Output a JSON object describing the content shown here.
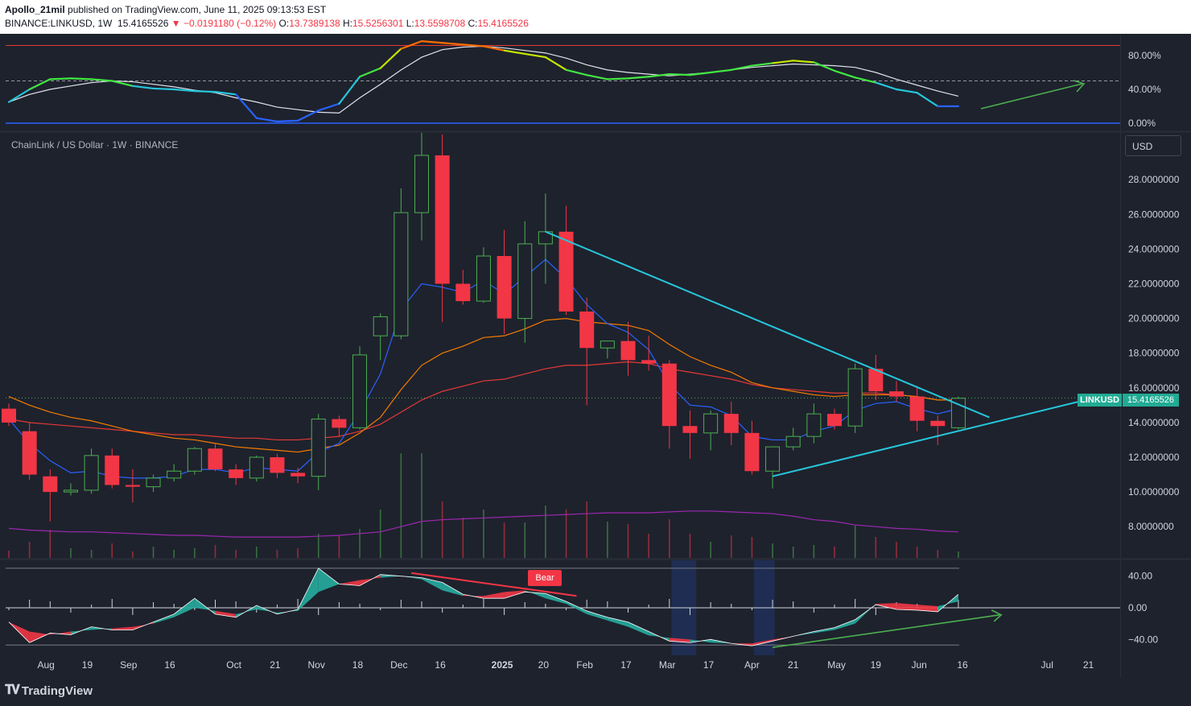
{
  "header": {
    "author": "Apollo_21mil",
    "published": "published on TradingView.com, June 11, 2025 09:13:53 EST",
    "symbol": "BINANCE:LINKUSD, 1W",
    "last": "15.4165526",
    "change": "▼ −0.0191180 (−0.12%)",
    "o_label": "O:",
    "o": "13.7389138",
    "h_label": "H:",
    "h": "15.5256301",
    "l_label": "L:",
    "l": "13.5598708",
    "c_label": "C:",
    "c": "15.4165526"
  },
  "main_legend": "ChainLink / US Dollar · 1W · BINANCE",
  "currency_button": "USD",
  "price_tag": {
    "symbol": "LINKUSD",
    "value": "15.4165526"
  },
  "bear_label": "Bear",
  "footer_logo": "TradingView",
  "colors": {
    "up": "#4caf50",
    "down": "#f23645",
    "bg": "#1e222d",
    "ema_fast": "#2962ff",
    "ema_mid": "#f57c00",
    "ema_slow": "#e53935",
    "volume_ma": "#9c27b0",
    "trend": "#26c6da"
  },
  "chart_data": [
    {
      "type": "candlestick",
      "title": "ChainLink / US Dollar · 1W · BINANCE",
      "x_ticks": [
        "Aug",
        "19",
        "Sep",
        "16",
        "Oct",
        "21",
        "Nov",
        "18",
        "Dec",
        "16",
        "2025",
        "20",
        "Feb",
        "17",
        "Mar",
        "17",
        "Apr",
        "21",
        "May",
        "19",
        "Jun",
        "16",
        "Jul",
        "21"
      ],
      "y_ticks": [
        "28.0000000",
        "26.0000000",
        "24.0000000",
        "22.0000000",
        "20.0000000",
        "18.0000000",
        "16.0000000",
        "14.0000000",
        "12.0000000",
        "10.0000000",
        "8.0000000"
      ],
      "ylim": [
        6.2,
        30.7
      ],
      "last_price": 15.4165526,
      "candles": [
        {
          "o": 14.8,
          "h": 15.1,
          "l": 13.8,
          "c": 14.0
        },
        {
          "o": 13.5,
          "h": 14.0,
          "l": 10.7,
          "c": 11.0
        },
        {
          "o": 10.9,
          "h": 11.3,
          "l": 8.3,
          "c": 10.0
        },
        {
          "o": 10.0,
          "h": 10.5,
          "l": 9.8,
          "c": 10.1
        },
        {
          "o": 10.1,
          "h": 12.5,
          "l": 9.9,
          "c": 12.1
        },
        {
          "o": 12.1,
          "h": 12.5,
          "l": 10.2,
          "c": 10.4
        },
        {
          "o": 10.4,
          "h": 11.3,
          "l": 9.4,
          "c": 10.3
        },
        {
          "o": 10.3,
          "h": 11.0,
          "l": 10.0,
          "c": 10.8
        },
        {
          "o": 10.8,
          "h": 11.6,
          "l": 10.6,
          "c": 11.2
        },
        {
          "o": 11.2,
          "h": 12.6,
          "l": 11.0,
          "c": 12.5
        },
        {
          "o": 12.5,
          "h": 12.8,
          "l": 11.2,
          "c": 11.3
        },
        {
          "o": 11.3,
          "h": 11.6,
          "l": 10.4,
          "c": 10.8
        },
        {
          "o": 10.8,
          "h": 12.1,
          "l": 10.6,
          "c": 12.0
        },
        {
          "o": 12.0,
          "h": 12.2,
          "l": 10.8,
          "c": 11.1
        },
        {
          "o": 11.1,
          "h": 11.4,
          "l": 10.5,
          "c": 10.9
        },
        {
          "o": 10.9,
          "h": 14.5,
          "l": 10.1,
          "c": 14.2
        },
        {
          "o": 14.2,
          "h": 14.4,
          "l": 13.2,
          "c": 13.7
        },
        {
          "o": 13.7,
          "h": 18.4,
          "l": 13.6,
          "c": 17.9
        },
        {
          "o": 19.0,
          "h": 20.3,
          "l": 17.6,
          "c": 20.1
        },
        {
          "o": 19.0,
          "h": 27.5,
          "l": 18.8,
          "c": 26.1
        },
        {
          "o": 26.1,
          "h": 30.7,
          "l": 24.5,
          "c": 29.4
        },
        {
          "o": 29.4,
          "h": 30.6,
          "l": 19.8,
          "c": 22.0
        },
        {
          "o": 22.0,
          "h": 22.8,
          "l": 20.8,
          "c": 21.0
        },
        {
          "o": 21.0,
          "h": 24.1,
          "l": 20.9,
          "c": 23.6
        },
        {
          "o": 23.6,
          "h": 25.1,
          "l": 19.1,
          "c": 20.0
        },
        {
          "o": 20.0,
          "h": 25.6,
          "l": 18.6,
          "c": 24.3
        },
        {
          "o": 24.3,
          "h": 27.2,
          "l": 22.0,
          "c": 25.0
        },
        {
          "o": 25.0,
          "h": 26.5,
          "l": 20.2,
          "c": 20.4
        },
        {
          "o": 20.4,
          "h": 21.2,
          "l": 15.0,
          "c": 18.3
        },
        {
          "o": 18.3,
          "h": 18.7,
          "l": 17.7,
          "c": 18.7
        },
        {
          "o": 18.7,
          "h": 19.8,
          "l": 16.7,
          "c": 17.6
        },
        {
          "o": 17.6,
          "h": 19.0,
          "l": 17.0,
          "c": 17.4
        },
        {
          "o": 17.4,
          "h": 17.6,
          "l": 12.5,
          "c": 13.8
        },
        {
          "o": 13.8,
          "h": 14.7,
          "l": 11.9,
          "c": 13.4
        },
        {
          "o": 13.4,
          "h": 14.7,
          "l": 12.4,
          "c": 14.5
        },
        {
          "o": 14.5,
          "h": 15.2,
          "l": 12.7,
          "c": 13.4
        },
        {
          "o": 13.4,
          "h": 14.1,
          "l": 11.0,
          "c": 11.2
        },
        {
          "o": 11.2,
          "h": 12.6,
          "l": 10.2,
          "c": 12.6
        },
        {
          "o": 12.6,
          "h": 13.7,
          "l": 12.4,
          "c": 13.2
        },
        {
          "o": 13.2,
          "h": 15.1,
          "l": 12.8,
          "c": 14.5
        },
        {
          "o": 14.5,
          "h": 14.8,
          "l": 13.6,
          "c": 13.8
        },
        {
          "o": 13.8,
          "h": 17.4,
          "l": 13.4,
          "c": 17.1
        },
        {
          "o": 17.1,
          "h": 17.9,
          "l": 15.3,
          "c": 15.8
        },
        {
          "o": 15.8,
          "h": 16.4,
          "l": 15.2,
          "c": 15.5
        },
        {
          "o": 15.5,
          "h": 16.1,
          "l": 13.5,
          "c": 14.1
        },
        {
          "o": 14.1,
          "h": 14.4,
          "l": 12.7,
          "c": 13.8
        },
        {
          "o": 13.7,
          "h": 15.5,
          "l": 13.6,
          "c": 15.4
        }
      ],
      "ema_fast": [
        14.2,
        12.8,
        11.8,
        11.1,
        11.2,
        10.9,
        10.8,
        10.8,
        10.9,
        11.3,
        11.3,
        11.1,
        11.4,
        11.3,
        11.2,
        12.3,
        12.8,
        14.6,
        16.8,
        20.5,
        22.0,
        21.8,
        21.5,
        22.2,
        21.4,
        22.4,
        23.4,
        22.3,
        20.8,
        19.7,
        19.2,
        18.2,
        16.2,
        15.0,
        14.9,
        14.4,
        13.2,
        13.0,
        13.0,
        13.5,
        13.8,
        14.7,
        15.1,
        15.2,
        14.8,
        14.5,
        14.8
      ],
      "ema_mid": [
        15.5,
        15.0,
        14.6,
        14.3,
        14.1,
        13.8,
        13.5,
        13.3,
        13.1,
        13.0,
        12.8,
        12.6,
        12.5,
        12.4,
        12.3,
        12.5,
        12.7,
        13.4,
        14.3,
        15.9,
        17.3,
        18.0,
        18.4,
        18.9,
        19.0,
        19.4,
        19.9,
        20.0,
        19.8,
        19.7,
        19.6,
        19.3,
        18.5,
        17.8,
        17.3,
        16.9,
        16.3,
        16.0,
        15.8,
        15.6,
        15.5,
        15.6,
        15.6,
        15.6,
        15.5,
        15.3,
        15.3
      ],
      "ema_slow": [
        14.2,
        14.0,
        13.9,
        13.8,
        13.7,
        13.6,
        13.5,
        13.4,
        13.3,
        13.3,
        13.2,
        13.1,
        13.1,
        13.0,
        13.0,
        13.1,
        13.2,
        13.5,
        13.9,
        14.6,
        15.3,
        15.8,
        16.1,
        16.4,
        16.5,
        16.8,
        17.1,
        17.3,
        17.3,
        17.4,
        17.5,
        17.4,
        17.1,
        16.9,
        16.7,
        16.5,
        16.2,
        16.0,
        15.9,
        15.8,
        15.7,
        15.7,
        15.7,
        15.6,
        15.5,
        15.3,
        15.3
      ],
      "volume_ma": [
        7.9,
        7.8,
        7.75,
        7.7,
        7.7,
        7.65,
        7.6,
        7.55,
        7.5,
        7.5,
        7.45,
        7.4,
        7.4,
        7.4,
        7.4,
        7.45,
        7.5,
        7.6,
        7.7,
        8.0,
        8.3,
        8.4,
        8.45,
        8.5,
        8.55,
        8.6,
        8.65,
        8.7,
        8.75,
        8.8,
        8.8,
        8.8,
        8.85,
        8.9,
        8.9,
        8.85,
        8.8,
        8.75,
        8.6,
        8.4,
        8.3,
        8.1,
        8.0,
        7.9,
        7.85,
        7.75,
        7.7
      ],
      "trendlines": [
        {
          "from": [
            26,
            25.0
          ],
          "to": [
            47.5,
            14.3
          ]
        },
        {
          "from": [
            37,
            10.9
          ],
          "to": [
            52.5,
            15.4
          ]
        }
      ]
    },
    {
      "type": "line",
      "name": "oscillator_top",
      "y_ticks": [
        "80.00%",
        "40.00%",
        "0.00%"
      ],
      "ylim": [
        0,
        100
      ],
      "reference_line": 50,
      "fast": [
        25,
        40,
        52,
        53,
        52,
        50,
        44,
        41,
        40,
        38,
        37,
        34,
        6,
        2,
        3,
        15,
        23,
        55,
        65,
        88,
        97,
        95,
        93,
        91,
        86,
        82,
        78,
        63,
        57,
        52,
        53,
        55,
        58,
        57,
        60,
        63,
        68,
        71,
        74,
        72,
        62,
        54,
        48,
        40,
        36,
        20,
        20
      ],
      "slow": [
        25,
        34,
        40,
        44,
        48,
        50,
        49,
        46,
        43,
        39,
        36,
        30,
        25,
        19,
        16,
        13,
        12,
        30,
        46,
        63,
        78,
        87,
        90,
        91,
        89,
        86,
        83,
        77,
        69,
        63,
        60,
        58,
        56,
        58,
        60,
        63,
        66,
        68,
        70,
        69,
        68,
        66,
        60,
        52,
        45,
        38,
        32
      ]
    },
    {
      "type": "area",
      "name": "oscillator_bottom",
      "y_ticks": [
        "40.00",
        "0.00",
        "−40.00"
      ],
      "ylim": [
        -60,
        60
      ],
      "upper_band": 50,
      "lower_band": -47,
      "fast": [
        -18,
        -44,
        -32,
        -34,
        -24,
        -28,
        -28,
        -18,
        -8,
        12,
        -8,
        -12,
        3,
        -8,
        -2,
        50,
        30,
        28,
        42,
        40,
        38,
        32,
        17,
        12,
        12,
        20,
        18,
        8,
        -4,
        -12,
        -18,
        -30,
        -42,
        -44,
        -40,
        -45,
        -48,
        -42,
        -36,
        -30,
        -25,
        -15,
        4,
        -2,
        -3,
        -5,
        17
      ],
      "slow": [
        -18,
        -30,
        -34,
        -30,
        -28,
        -26,
        -24,
        -20,
        -12,
        0,
        -4,
        -8,
        -2,
        -6,
        -4,
        20,
        30,
        35,
        38,
        40,
        36,
        22,
        15,
        15,
        20,
        22,
        12,
        5,
        -8,
        -16,
        -24,
        -35,
        -38,
        -40,
        -44,
        -45,
        -45,
        -40,
        -36,
        -32,
        -28,
        -20,
        5,
        6,
        4,
        2,
        8
      ],
      "shaded_periods": [
        [
          32.1,
          33.3
        ],
        [
          36.1,
          37.1
        ]
      ],
      "divergences": [
        {
          "from": [
            19.5,
            44
          ],
          "to": [
            27.5,
            15
          ]
        },
        {
          "from": [
            37,
            -50
          ],
          "to": [
            48,
            -9
          ]
        }
      ]
    }
  ]
}
